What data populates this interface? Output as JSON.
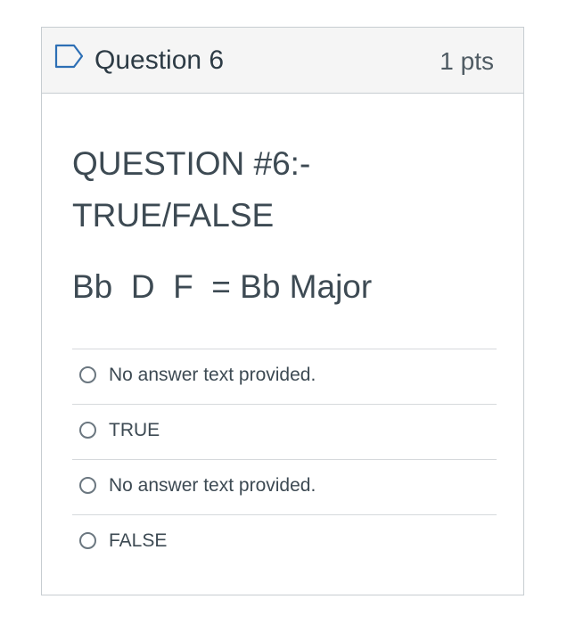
{
  "question": {
    "title": "Question 6",
    "points": "1 pts",
    "text_line1": "QUESTION #6:-",
    "text_line2": "TRUE/FALSE",
    "chord_text": "Bb  D  F  = Bb Major"
  },
  "answers": [
    {
      "label": "No answer text provided."
    },
    {
      "label": "TRUE"
    },
    {
      "label": "No answer text provided."
    },
    {
      "label": "FALSE"
    }
  ],
  "icons": {
    "flag": "bookmark-flag-icon",
    "radio": "radio-circle-icon"
  },
  "colors": {
    "header_bg": "#f5f5f5",
    "border": "#c7cdd1",
    "flag_icon": "#2d6fb5",
    "text": "#2d3b45"
  }
}
